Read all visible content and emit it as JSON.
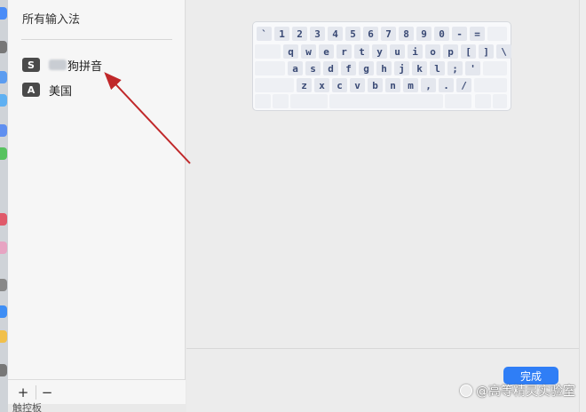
{
  "sidebar": {
    "title": "所有输入法",
    "methods": [
      {
        "icon_text": "S",
        "label": "狗拼音",
        "blurred_prefix": true
      },
      {
        "icon_text": "A",
        "label": "美国",
        "blurred_prefix": false
      }
    ],
    "add_label": "+",
    "remove_label": "−"
  },
  "keyboard": {
    "rows": [
      [
        "`",
        "1",
        "2",
        "3",
        "4",
        "5",
        "6",
        "7",
        "8",
        "9",
        "0",
        "-",
        "="
      ],
      [
        "q",
        "w",
        "e",
        "r",
        "t",
        "y",
        "u",
        "i",
        "o",
        "p",
        "[",
        "]",
        "\\"
      ],
      [
        "a",
        "s",
        "d",
        "f",
        "g",
        "h",
        "j",
        "k",
        "l",
        ";",
        "'"
      ],
      [
        "z",
        "x",
        "c",
        "v",
        "b",
        "n",
        "m",
        ",",
        ".",
        "/"
      ]
    ]
  },
  "footer": {
    "done_label": "完成"
  },
  "bottom_cutoff_text": "触控板",
  "watermark": "@高等精灵实验室",
  "colors": {
    "accent": "#2f7ef6",
    "arrow": "#c0282a",
    "key_text": "#3a4a75"
  }
}
